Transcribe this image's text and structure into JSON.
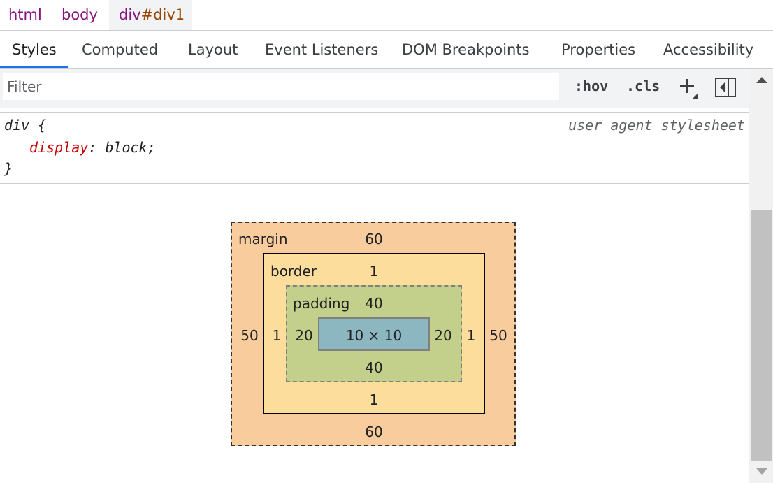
{
  "breadcrumb": {
    "items": [
      {
        "tag": "html",
        "suffix": ""
      },
      {
        "tag": "body",
        "suffix": ""
      },
      {
        "tag": "div",
        "suffix": "#div1"
      }
    ]
  },
  "tabs": [
    "Styles",
    "Computed",
    "Layout",
    "Event Listeners",
    "DOM Breakpoints",
    "Properties",
    "Accessibility"
  ],
  "active_tab": "Styles",
  "filter": {
    "placeholder": "Filter",
    "value": ""
  },
  "toolbar": {
    "hov": ":hov",
    "cls": ".cls",
    "new_rule_icon": "plus-icon",
    "sidebar_toggle_icon": "toggle-sidebar-icon"
  },
  "rule": {
    "selector": "div {",
    "source": "user agent stylesheet",
    "property": "display",
    "colon": ": ",
    "value": "block;",
    "close": "}"
  },
  "box_model": {
    "margin": {
      "label": "margin",
      "top": "60",
      "right": "50",
      "bottom": "60",
      "left": "50"
    },
    "border": {
      "label": "border",
      "top": "1",
      "right": "1",
      "bottom": "1",
      "left": "1"
    },
    "padding": {
      "label": "padding",
      "top": "40",
      "right": "20",
      "bottom": "40",
      "left": "20"
    },
    "content": {
      "size": "10 × 10"
    }
  },
  "colors": {
    "margin": "#f9cc9d",
    "border": "#fddd9b",
    "padding": "#c3d08b",
    "content": "#8cb6c0",
    "active_tab": "#1a73e8",
    "property": "#c80000"
  }
}
